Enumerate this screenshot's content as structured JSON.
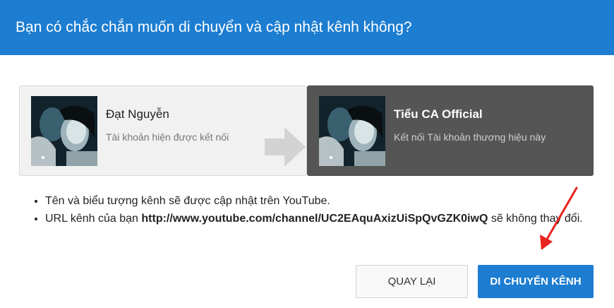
{
  "dialog": {
    "title": "Bạn có chắc chắn muốn di chuyển và cập nhật kênh không?"
  },
  "source_account": {
    "name": "Đạt Nguyễn",
    "subtitle": "Tài khoản hiện được kết nối"
  },
  "target_account": {
    "name": "Tiểu CA Official",
    "subtitle": "Kết nối Tài khoản thương hiệu này"
  },
  "notes": {
    "line1": "Tên và biểu tượng kênh sẽ được cập nhật trên YouTube.",
    "line2_prefix": "URL kênh của bạn ",
    "line2_url": "http://www.youtube.com/channel/UC2EAquAxizUiSpQvGZK0iwQ",
    "line2_suffix": " sẽ không thay đổi."
  },
  "buttons": {
    "back_label": "QUAY LẠI",
    "move_label": "DI CHUYỂN KÊNH"
  },
  "colors": {
    "primary": "#1c7dd1",
    "target_card": "#555555",
    "annotation_arrow": "#e8231f"
  },
  "icons": {
    "transfer_arrow": "right-arrow-icon",
    "annotation": "red-pointer-arrow-icon"
  }
}
